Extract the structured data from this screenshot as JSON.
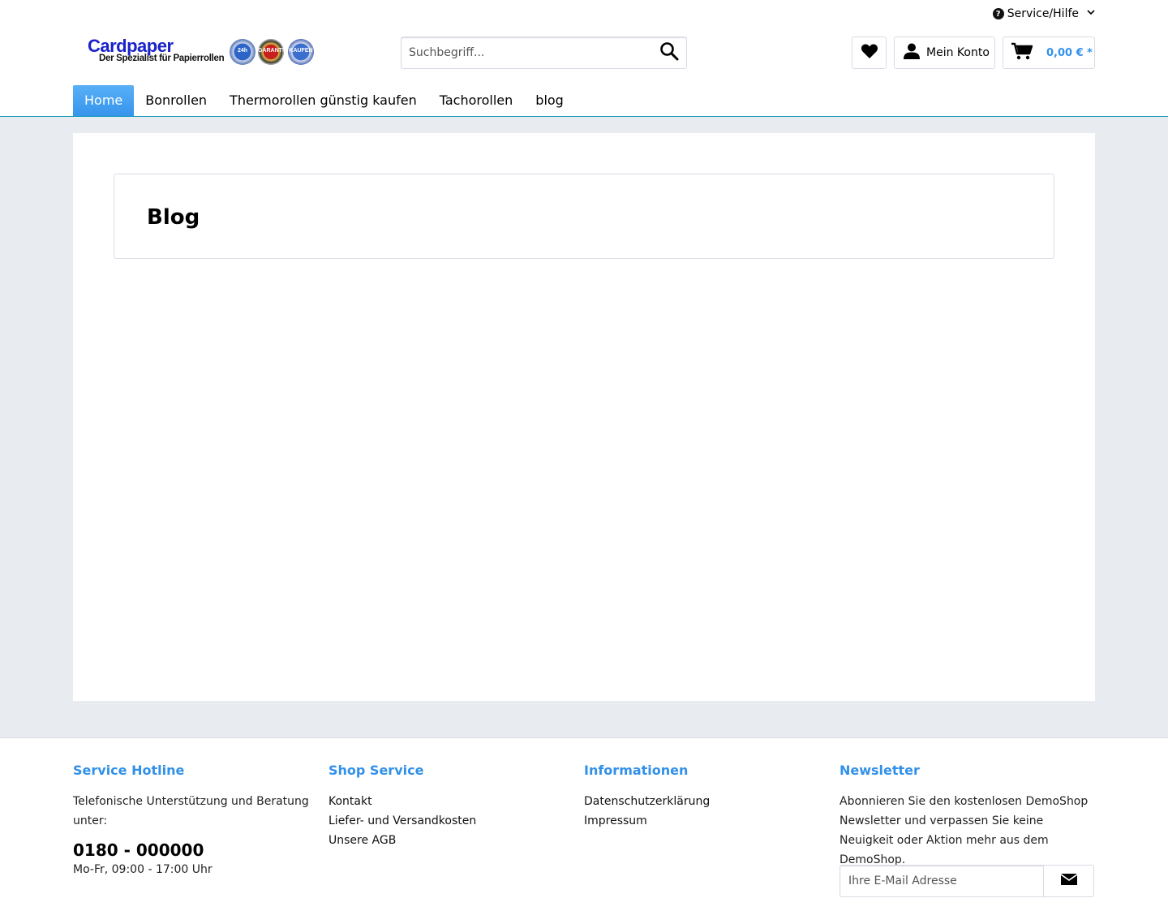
{
  "topbar": {
    "service_label": "Service/Hilfe",
    "service_icon": "question-circle-icon",
    "chevron_icon": "chevron-down-icon"
  },
  "header": {
    "logo": {
      "brand": "Cardpaper",
      "tagline": "Der Spezialist für Papierrollen",
      "seals": [
        "24h",
        "GARANTIE",
        "KAUFEN"
      ]
    },
    "search_placeholder": "Suchbegriff...",
    "search_icon": "search-icon",
    "wishlist_icon": "heart-icon",
    "account_label": "Mein Konto",
    "account_icon": "user-icon",
    "cart_icon": "cart-icon",
    "cart_amount": "0,00 € *"
  },
  "nav": {
    "items": [
      "Home",
      "Bonrollen",
      "Thermorollen günstig kaufen",
      "Tachorollen",
      "blog"
    ],
    "active": "Home"
  },
  "main": {
    "title": "Blog"
  },
  "footer": {
    "hotline": {
      "heading": "Service Hotline",
      "text": "Telefonische Unterstützung und Beratung unter:",
      "phone": "0180 - 000000",
      "hours": "Mo-Fr, 09:00 - 17:00 Uhr"
    },
    "shop_service": {
      "heading": "Shop Service",
      "links": [
        "Kontakt",
        "Liefer- und Versandkosten",
        "Unsere AGB"
      ]
    },
    "informationen": {
      "heading": "Informationen",
      "links": [
        "Datenschutzerklärung",
        "Impressum"
      ]
    },
    "newsletter": {
      "heading": "Newsletter",
      "text": "Abonnieren Sie den kostenlosen DemoShop Newsletter und verpassen Sie keine Neuigkeit oder Aktion mehr aus dem DemoShop.",
      "placeholder": "Ihre E-Mail Adresse",
      "submit_icon": "envelope-icon"
    }
  },
  "colors": {
    "accent": "#3190e8",
    "nav_active": "#3694eb",
    "nav_line": "#0b97b8",
    "page_bg": "#e8ebef"
  }
}
